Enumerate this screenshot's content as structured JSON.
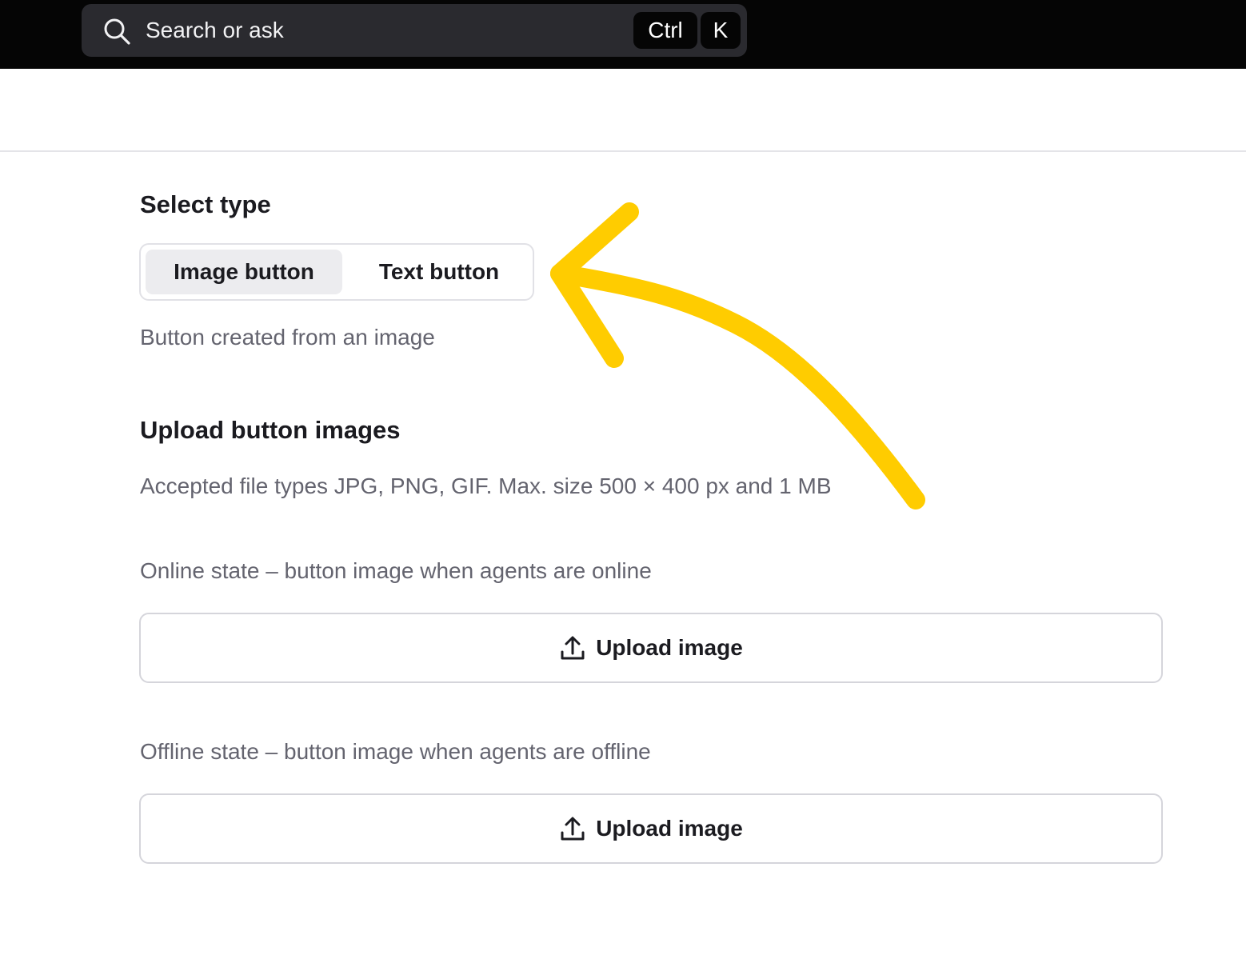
{
  "search": {
    "placeholder": "Search or ask",
    "shortcut_keys": [
      "Ctrl",
      "K"
    ],
    "icon": "search-icon"
  },
  "select_type": {
    "title": "Select type",
    "options": [
      {
        "label": "Image button",
        "selected": true
      },
      {
        "label": "Text button",
        "selected": false
      }
    ],
    "description": "Button created from an image"
  },
  "upload": {
    "title": "Upload button images",
    "accepted_note": "Accepted file types JPG, PNG, GIF. Max. size 500 × 400 px and 1 MB",
    "online_label": "Online state – button image when agents are online",
    "offline_label": "Offline state – button image when agents are offline",
    "upload_button_label": "Upload image",
    "upload_icon": "upload-icon"
  },
  "colors": {
    "topbar": "#050505",
    "search_bg": "#2a2a2f",
    "annotation_arrow": "#ffcc00",
    "selected_segment_bg": "#ececef",
    "muted_text": "#64646f"
  }
}
